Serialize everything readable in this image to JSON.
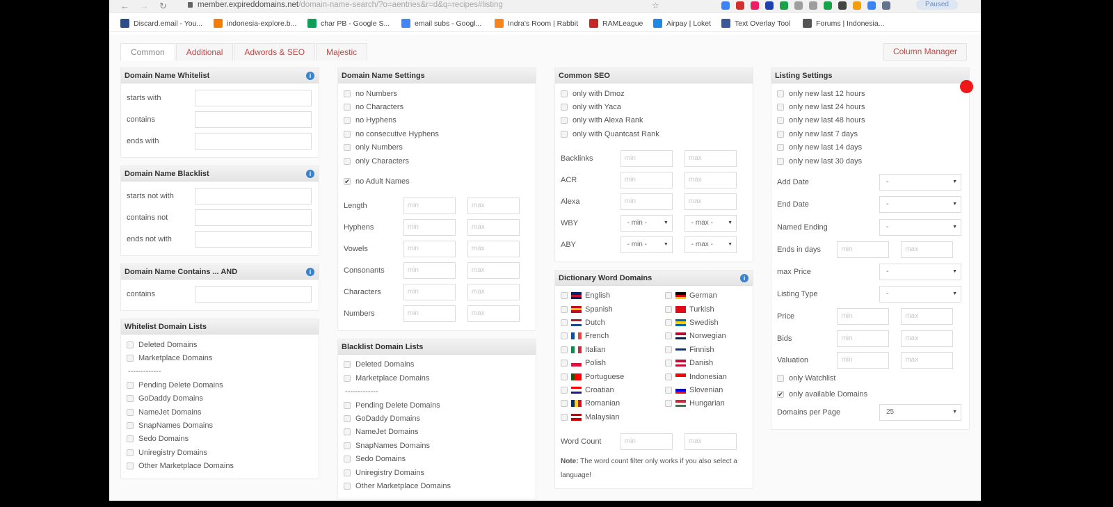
{
  "browser": {
    "url_host": "member.expireddomains.net",
    "url_path": "/domain-name-search/?o=aentries&r=d&q=recipes#listing",
    "paused_label": "Paused",
    "bookmarks": [
      {
        "label": "Discard.email - You...",
        "color": "#2b4d8c"
      },
      {
        "label": "indonesia-explore.b...",
        "color": "#f57c00"
      },
      {
        "label": "char PB - Google S...",
        "color": "#0f9d58"
      },
      {
        "label": "email subs - Googl...",
        "color": "#4285f4"
      },
      {
        "label": "Indra's Room | Rabbit",
        "color": "#f4851f"
      },
      {
        "label": "RAMLeague",
        "color": "#c62828"
      },
      {
        "label": "Airpay | Loket",
        "color": "#1e88e5"
      },
      {
        "label": "Text Overlay Tool",
        "color": "#3b5998"
      },
      {
        "label": "Forums | Indonesia...",
        "color": "#555555"
      }
    ]
  },
  "tabs": [
    "Common",
    "Additional",
    "Adwords & SEO",
    "Majestic"
  ],
  "active_tab": "Common",
  "column_manager": "Column Manager",
  "columns": [
    [
      {
        "title": "Domain Name Whitelist",
        "info": true,
        "rows": [
          {
            "t": "text",
            "label": "starts with"
          },
          {
            "t": "text",
            "label": "contains"
          },
          {
            "t": "text",
            "label": "ends with"
          }
        ]
      },
      {
        "title": "Domain Name Blacklist",
        "info": true,
        "rows": [
          {
            "t": "text",
            "label": "starts not with"
          },
          {
            "t": "text",
            "label": "contains not"
          },
          {
            "t": "text",
            "label": "ends not with"
          }
        ]
      },
      {
        "title": "Domain Name Contains ... AND",
        "info": true,
        "rows": [
          {
            "t": "text",
            "label": "contains"
          }
        ]
      },
      {
        "title": "Whitelist Domain Lists",
        "rows": [
          {
            "t": "check",
            "label": "Deleted Domains"
          },
          {
            "t": "check",
            "label": "Marketplace Domains"
          },
          {
            "t": "sep",
            "label": "-------------"
          },
          {
            "t": "check",
            "label": "Pending Delete Domains"
          },
          {
            "t": "check",
            "label": "GoDaddy Domains"
          },
          {
            "t": "check",
            "label": "NameJet Domains"
          },
          {
            "t": "check",
            "label": "SnapNames Domains"
          },
          {
            "t": "check",
            "label": "Sedo Domains"
          },
          {
            "t": "check",
            "label": "Uniregistry Domains"
          },
          {
            "t": "check",
            "label": "Other Marketplace Domains"
          }
        ]
      }
    ],
    [
      {
        "title": "Domain Name Settings",
        "rows": [
          {
            "t": "check",
            "label": "no Numbers"
          },
          {
            "t": "check",
            "label": "no Characters"
          },
          {
            "t": "check",
            "label": "no Hyphens"
          },
          {
            "t": "check",
            "label": "no consecutive Hyphens"
          },
          {
            "t": "check",
            "label": "only Numbers"
          },
          {
            "t": "check",
            "label": "only Characters"
          },
          {
            "t": "gap"
          },
          {
            "t": "check",
            "label": "no Adult Names",
            "checked": true
          },
          {
            "t": "gap"
          },
          {
            "t": "minmax",
            "label": "Length",
            "min": "min",
            "max": "max"
          },
          {
            "t": "minmax",
            "label": "Hyphens",
            "min": "min",
            "max": "max"
          },
          {
            "t": "minmax",
            "label": "Vowels",
            "min": "min",
            "max": "max"
          },
          {
            "t": "minmax",
            "label": "Consonants",
            "min": "min",
            "max": "max"
          },
          {
            "t": "minmax",
            "label": "Characters",
            "min": "min",
            "max": "max"
          },
          {
            "t": "minmax",
            "label": "Numbers",
            "min": "min",
            "max": "max"
          }
        ]
      },
      {
        "title": "Blacklist Domain Lists",
        "rows": [
          {
            "t": "check",
            "label": "Deleted Domains"
          },
          {
            "t": "check",
            "label": "Marketplace Domains"
          },
          {
            "t": "sep",
            "label": "-------------"
          },
          {
            "t": "check",
            "label": "Pending Delete Domains"
          },
          {
            "t": "check",
            "label": "GoDaddy Domains"
          },
          {
            "t": "check",
            "label": "NameJet Domains"
          },
          {
            "t": "check",
            "label": "SnapNames Domains"
          },
          {
            "t": "check",
            "label": "Sedo Domains"
          },
          {
            "t": "check",
            "label": "Uniregistry Domains"
          },
          {
            "t": "check",
            "label": "Other Marketplace Domains"
          }
        ]
      }
    ],
    [
      {
        "title": "Common SEO",
        "rows": [
          {
            "t": "check",
            "label": "only with Dmoz"
          },
          {
            "t": "check",
            "label": "only with Yaca"
          },
          {
            "t": "check",
            "label": "only with Alexa Rank"
          },
          {
            "t": "check",
            "label": "only with Quantcast Rank"
          },
          {
            "t": "gap"
          },
          {
            "t": "minmax",
            "label": "Backlinks",
            "min": "min",
            "max": "max"
          },
          {
            "t": "minmax",
            "label": "ACR",
            "min": "min",
            "max": "max"
          },
          {
            "t": "minmax",
            "label": "Alexa",
            "min": "min",
            "max": "max"
          },
          {
            "t": "selpair",
            "label": "WBY",
            "min": "- min -",
            "max": "- max -"
          },
          {
            "t": "selpair",
            "label": "ABY",
            "min": "- min -",
            "max": "- max -"
          }
        ]
      },
      {
        "title": "Dictionary Word Domains",
        "info": true,
        "rows": [
          {
            "t": "langs",
            "items": [
              {
                "label": "English",
                "flag": [
                  "#012169",
                  "#c8102e",
                  "#012169"
                ]
              },
              {
                "label": "German",
                "flag": [
                  "#000000",
                  "#dd0000",
                  "#ffce00"
                ]
              },
              {
                "label": "Spanish",
                "flag": [
                  "#c60b1e",
                  "#ffc400",
                  "#c60b1e"
                ]
              },
              {
                "label": "Turkish",
                "flag": [
                  "#e30a17",
                  "#e30a17",
                  "#e30a17"
                ]
              },
              {
                "label": "Dutch",
                "flag": [
                  "#ae1c28",
                  "#ffffff",
                  "#21468b"
                ]
              },
              {
                "label": "Swedish",
                "flag": [
                  "#006aa7",
                  "#fecc00",
                  "#006aa7"
                ]
              },
              {
                "label": "French",
                "flag": [
                  "#0055a4",
                  "#ffffff",
                  "#ef4135"
                ],
                "vertical": true
              },
              {
                "label": "Norwegian",
                "flag": [
                  "#ba0c2f",
                  "#ffffff",
                  "#00205b"
                ]
              },
              {
                "label": "Italian",
                "flag": [
                  "#009246",
                  "#ffffff",
                  "#ce2b37"
                ],
                "vertical": true
              },
              {
                "label": "Finnish",
                "flag": [
                  "#ffffff",
                  "#003580",
                  "#ffffff"
                ]
              },
              {
                "label": "Polish",
                "flag": [
                  "#ffffff",
                  "#dc143c"
                ]
              },
              {
                "label": "Danish",
                "flag": [
                  "#c60c30",
                  "#ffffff",
                  "#c60c30"
                ]
              },
              {
                "label": "Portuguese",
                "flag": [
                  "#006600",
                  "#ff0000",
                  "#ff0000"
                ],
                "vertical": true
              },
              {
                "label": "Indonesian",
                "flag": [
                  "#ff0000",
                  "#ffffff"
                ]
              },
              {
                "label": "Croatian",
                "flag": [
                  "#ff0000",
                  "#ffffff",
                  "#171796"
                ]
              },
              {
                "label": "Slovenian",
                "flag": [
                  "#ffffff",
                  "#0000ff",
                  "#ff0000"
                ]
              },
              {
                "label": "Romanian",
                "flag": [
                  "#002b7f",
                  "#fcd116",
                  "#ce1126"
                ],
                "vertical": true
              },
              {
                "label": "Hungarian",
                "flag": [
                  "#ce2939",
                  "#ffffff",
                  "#477050"
                ]
              },
              {
                "label": "Malaysian",
                "flag": [
                  "#cc0001",
                  "#ffffff",
                  "#cc0001"
                ]
              }
            ]
          },
          {
            "t": "gap"
          },
          {
            "t": "minmax",
            "label": "Word Count",
            "min": "min",
            "max": "max"
          },
          {
            "t": "note",
            "bold": "Note:",
            "text": " The word count filter only works if you also select a language!"
          }
        ]
      }
    ],
    [
      {
        "title": "Listing Settings",
        "rows": [
          {
            "t": "check",
            "label": "only new last 12 hours"
          },
          {
            "t": "check",
            "label": "only new last 24 hours"
          },
          {
            "t": "check",
            "label": "only new last 48 hours"
          },
          {
            "t": "check",
            "label": "only new last 7 days"
          },
          {
            "t": "check",
            "label": "only new last 14 days"
          },
          {
            "t": "check",
            "label": "only new last 30 days"
          },
          {
            "t": "select",
            "label": "Add Date",
            "value": "-"
          },
          {
            "t": "select",
            "label": "End Date",
            "value": "-"
          },
          {
            "t": "select",
            "label": "Named Ending",
            "value": "-"
          },
          {
            "t": "minmax",
            "label": "Ends in days",
            "min": "min",
            "max": "max"
          },
          {
            "t": "select",
            "label": "max Price",
            "value": "-"
          },
          {
            "t": "select",
            "label": "Listing Type",
            "value": "-"
          },
          {
            "t": "minmax",
            "label": "Price",
            "min": "min",
            "max": "max"
          },
          {
            "t": "minmax",
            "label": "Bids",
            "min": "min",
            "max": "max"
          },
          {
            "t": "minmax",
            "label": "Valuation",
            "min": "min",
            "max": "max"
          },
          {
            "t": "check",
            "label": "only Watchlist"
          },
          {
            "t": "check",
            "label": "only available Domains",
            "checked": true
          },
          {
            "t": "select",
            "label": "Domains per Page",
            "value": "25"
          }
        ]
      }
    ]
  ]
}
